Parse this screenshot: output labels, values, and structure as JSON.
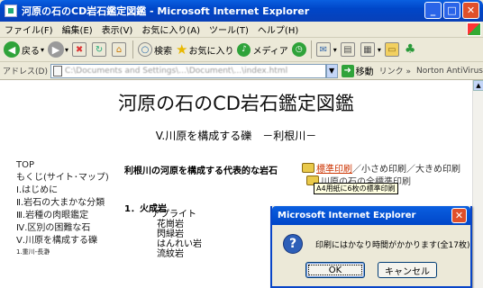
{
  "window": {
    "title": "河原の石のCD岩石鑑定図鑑 - Microsoft Internet Explorer",
    "minimize": "_",
    "maximize": "□",
    "close": "✕"
  },
  "menubar": [
    "ファイル(F)",
    "編集(E)",
    "表示(V)",
    "お気に入り(A)",
    "ツール(T)",
    "ヘルプ(H)"
  ],
  "toolbar": {
    "back_label": "戻る",
    "search_label": "検索",
    "favorites_label": "お気に入り",
    "media_label": "メディア"
  },
  "address": {
    "label": "アドレス(D)",
    "value": "C:\\Documents and Settings\\...\\Document\\...\\index.html",
    "go_label": "移動",
    "links_label": "リンク »",
    "antivirus_label": "Norton AntiVirus"
  },
  "page": {
    "title": "河原の石のCD岩石鑑定図鑑",
    "section_title": "V.川原を構成する礫　－利根川－",
    "nav": [
      "TOP",
      "もくじ(サイト･マップ)",
      "Ⅰ.はじめに",
      "Ⅱ.岩石の大まかな分類",
      "Ⅲ.岩種の肉眼鑑定",
      "Ⅳ.区別の困難な石",
      "Ⅴ.川原を構成する礫"
    ],
    "nav_sub": "1.重川-長瀞",
    "intro": "利根川の河原を構成する代表的な岩石",
    "print_standard": "標準印刷",
    "print_small": "小さめ印刷",
    "print_large": "大きめ印刷",
    "print_row2": "川原の石の全標準印刷",
    "tooltip": "A4用紙に6枚の標準印刷",
    "list_heading": "1．火成岩",
    "rocks": [
      "アプライト",
      "花崗岩",
      "閃緑岩",
      "はんれい岩",
      "流紋岩"
    ]
  },
  "dialog": {
    "title": "Microsoft Internet Explorer",
    "message": "印刷にはかなり時間がかかります(全17枚)",
    "ok_label": "OK",
    "cancel_label": "キャンセル",
    "close": "✕"
  }
}
